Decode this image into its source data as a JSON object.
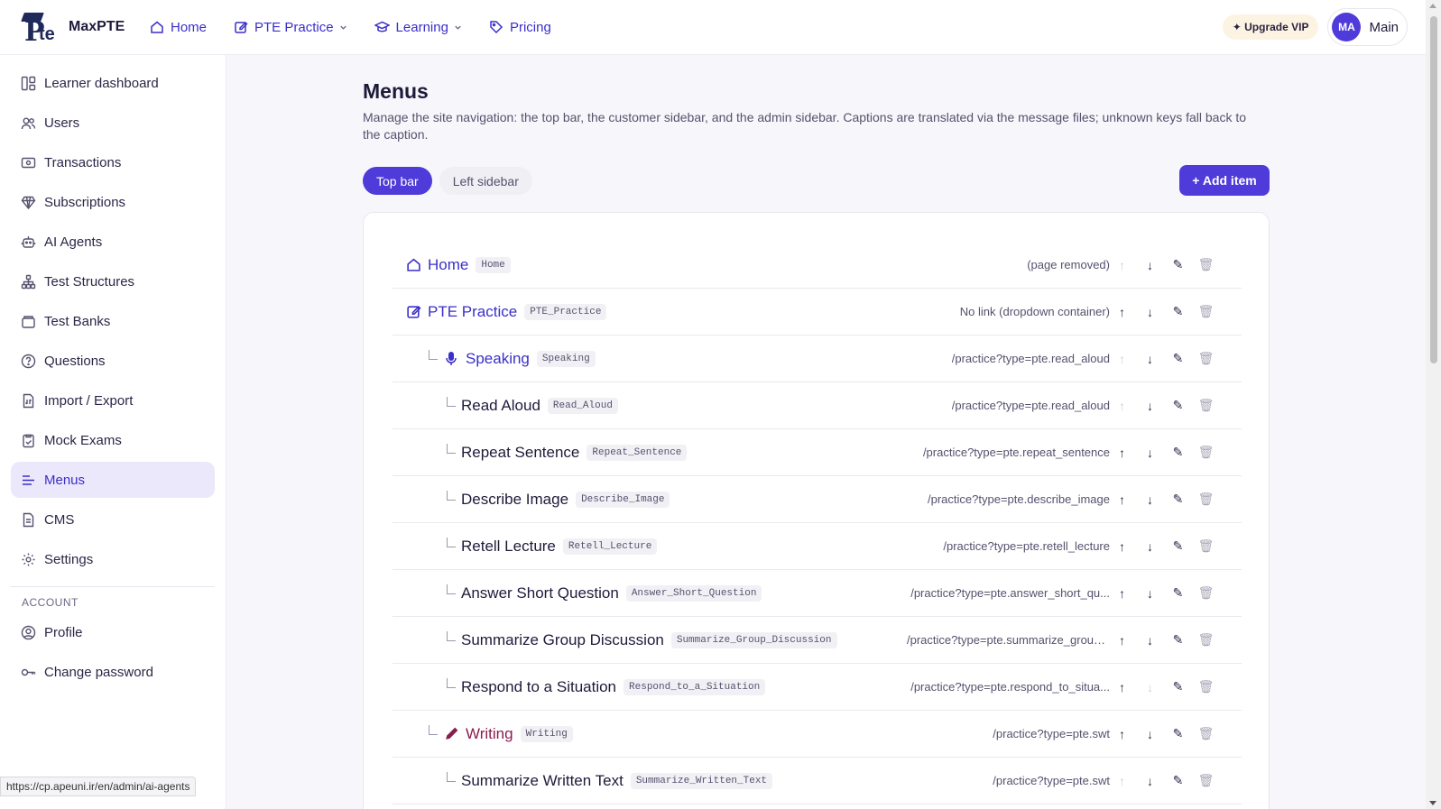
{
  "brand": {
    "name": "MaxPTE"
  },
  "topnav": [
    {
      "label": "Home",
      "icon": "home-icon"
    },
    {
      "label": "PTE Practice",
      "icon": "edit-icon",
      "dropdown": true
    },
    {
      "label": "Learning",
      "icon": "graduation-cap-icon",
      "dropdown": true
    },
    {
      "label": "Pricing",
      "icon": "tag-icon"
    }
  ],
  "user": {
    "vip_label": "✦ Upgrade VIP",
    "initials": "MA",
    "name": "Main"
  },
  "sidebar": {
    "items": [
      {
        "label": "Learner dashboard",
        "icon": "dashboard-icon"
      },
      {
        "label": "Users",
        "icon": "users-icon"
      },
      {
        "label": "Transactions",
        "icon": "transactions-icon"
      },
      {
        "label": "Subscriptions",
        "icon": "diamond-icon"
      },
      {
        "label": "AI Agents",
        "icon": "robot-icon"
      },
      {
        "label": "Test Structures",
        "icon": "hierarchy-icon"
      },
      {
        "label": "Test Banks",
        "icon": "bank-icon"
      },
      {
        "label": "Questions",
        "icon": "question-icon"
      },
      {
        "label": "Import / Export",
        "icon": "file-transfer-icon"
      },
      {
        "label": "Mock Exams",
        "icon": "clipboard-icon"
      },
      {
        "label": "Menus",
        "icon": "menu-lines-icon",
        "active": true
      },
      {
        "label": "CMS",
        "icon": "document-icon"
      },
      {
        "label": "Settings",
        "icon": "gear-icon"
      }
    ],
    "account_heading": "ACCOUNT",
    "account_items": [
      {
        "label": "Profile",
        "icon": "profile-icon"
      },
      {
        "label": "Change password",
        "icon": "key-icon"
      }
    ]
  },
  "status_url": "https://cp.apeuni.ir/en/admin/ai-agents",
  "page": {
    "title": "Menus",
    "description": "Manage the site navigation: the top bar, the customer sidebar, and the admin sidebar. Captions are translated via the message files; unknown keys fall back to the caption.",
    "tabs": [
      {
        "label": "Top bar",
        "active": true
      },
      {
        "label": "Left sidebar",
        "active": false
      }
    ],
    "add_label": "+ Add item"
  },
  "menu_rows": [
    {
      "label": "Home",
      "key": "Home",
      "link": "(page removed)",
      "level": 0,
      "icon": "home-icon",
      "up_enabled": false,
      "down_enabled": true
    },
    {
      "label": "PTE Practice",
      "key": "PTE_Practice",
      "link": "No link (dropdown container)",
      "level": 0,
      "icon": "edit-icon",
      "up_enabled": true,
      "down_enabled": true
    },
    {
      "label": "Speaking",
      "key": "Speaking",
      "link": "/practice?type=pte.read_aloud",
      "level": 1,
      "icon": "microphone-icon",
      "style": "speaking",
      "up_enabled": false,
      "down_enabled": true
    },
    {
      "label": "Read Aloud",
      "key": "Read_Aloud",
      "link": "/practice?type=pte.read_aloud",
      "level": 2,
      "up_enabled": false,
      "down_enabled": true
    },
    {
      "label": "Repeat Sentence",
      "key": "Repeat_Sentence",
      "link": "/practice?type=pte.repeat_sentence",
      "level": 2,
      "up_enabled": true,
      "down_enabled": true
    },
    {
      "label": "Describe Image",
      "key": "Describe_Image",
      "link": "/practice?type=pte.describe_image",
      "level": 2,
      "up_enabled": true,
      "down_enabled": true
    },
    {
      "label": "Retell Lecture",
      "key": "Retell_Lecture",
      "link": "/practice?type=pte.retell_lecture",
      "level": 2,
      "up_enabled": true,
      "down_enabled": true
    },
    {
      "label": "Answer Short Question",
      "key": "Answer_Short_Question",
      "link": "/practice?type=pte.answer_short_qu...",
      "level": 2,
      "up_enabled": true,
      "down_enabled": true
    },
    {
      "label": "Summarize Group Discussion",
      "key": "Summarize_Group_Discussion",
      "link": "/practice?type=pte.summarize_group...",
      "level": 2,
      "up_enabled": true,
      "down_enabled": true
    },
    {
      "label": "Respond to a Situation",
      "key": "Respond_to_a_Situation",
      "link": "/practice?type=pte.respond_to_situa...",
      "level": 2,
      "up_enabled": true,
      "down_enabled": false
    },
    {
      "label": "Writing",
      "key": "Writing",
      "link": "/practice?type=pte.swt",
      "level": 1,
      "icon": "pen-icon",
      "style": "writing",
      "up_enabled": true,
      "down_enabled": true
    },
    {
      "label": "Summarize Written Text",
      "key": "Summarize_Written_Text",
      "link": "/practice?type=pte.swt",
      "level": 2,
      "up_enabled": false,
      "down_enabled": true
    }
  ],
  "row_actions": {
    "up": "↑",
    "down": "↓",
    "edit": "✎",
    "delete": "🗑"
  },
  "colors": {
    "accent": "#4f3bd9",
    "accent_text": "#3b2fc9",
    "writing": "#8a1d4f",
    "vip_bg": "#fdf3e2"
  }
}
